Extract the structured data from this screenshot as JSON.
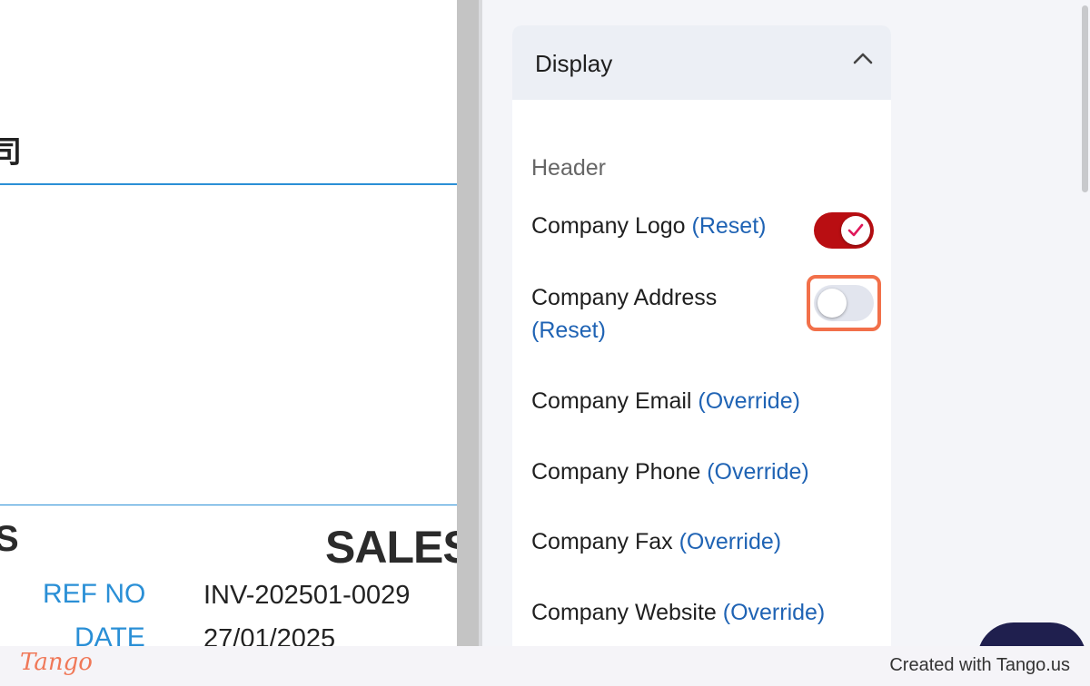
{
  "preview": {
    "company_name_fragment": "司",
    "left_heading_fragment": "S",
    "doc_title": "SALES",
    "ref_label": "REF NO",
    "ref_value": "INV-202501-0029",
    "date_label": "DATE",
    "date_value": "27/01/2025"
  },
  "panel": {
    "title": "Display",
    "section_header": "Header",
    "rows": [
      {
        "label": "Company Logo",
        "link": "(Reset)",
        "toggle": "on"
      },
      {
        "label": "Company Address",
        "link": "(Reset)",
        "toggle": "off"
      },
      {
        "label": "Company Email",
        "link": "(Override)"
      },
      {
        "label": "Company Phone",
        "link": "(Override)"
      },
      {
        "label": "Company Fax",
        "link": "(Override)"
      },
      {
        "label": "Company Website",
        "link": "(Override)"
      }
    ],
    "icons": {
      "collapse": "chevron-up-icon",
      "check": "checkmark-icon"
    }
  },
  "footer": {
    "brand": "Tango",
    "credit": "Created with Tango.us"
  },
  "colors": {
    "accent_blue": "#2a8fd6",
    "link_blue": "#1f63b4",
    "toggle_on": "#b90e12",
    "highlight": "#f2704a",
    "brand": "#f07858"
  }
}
